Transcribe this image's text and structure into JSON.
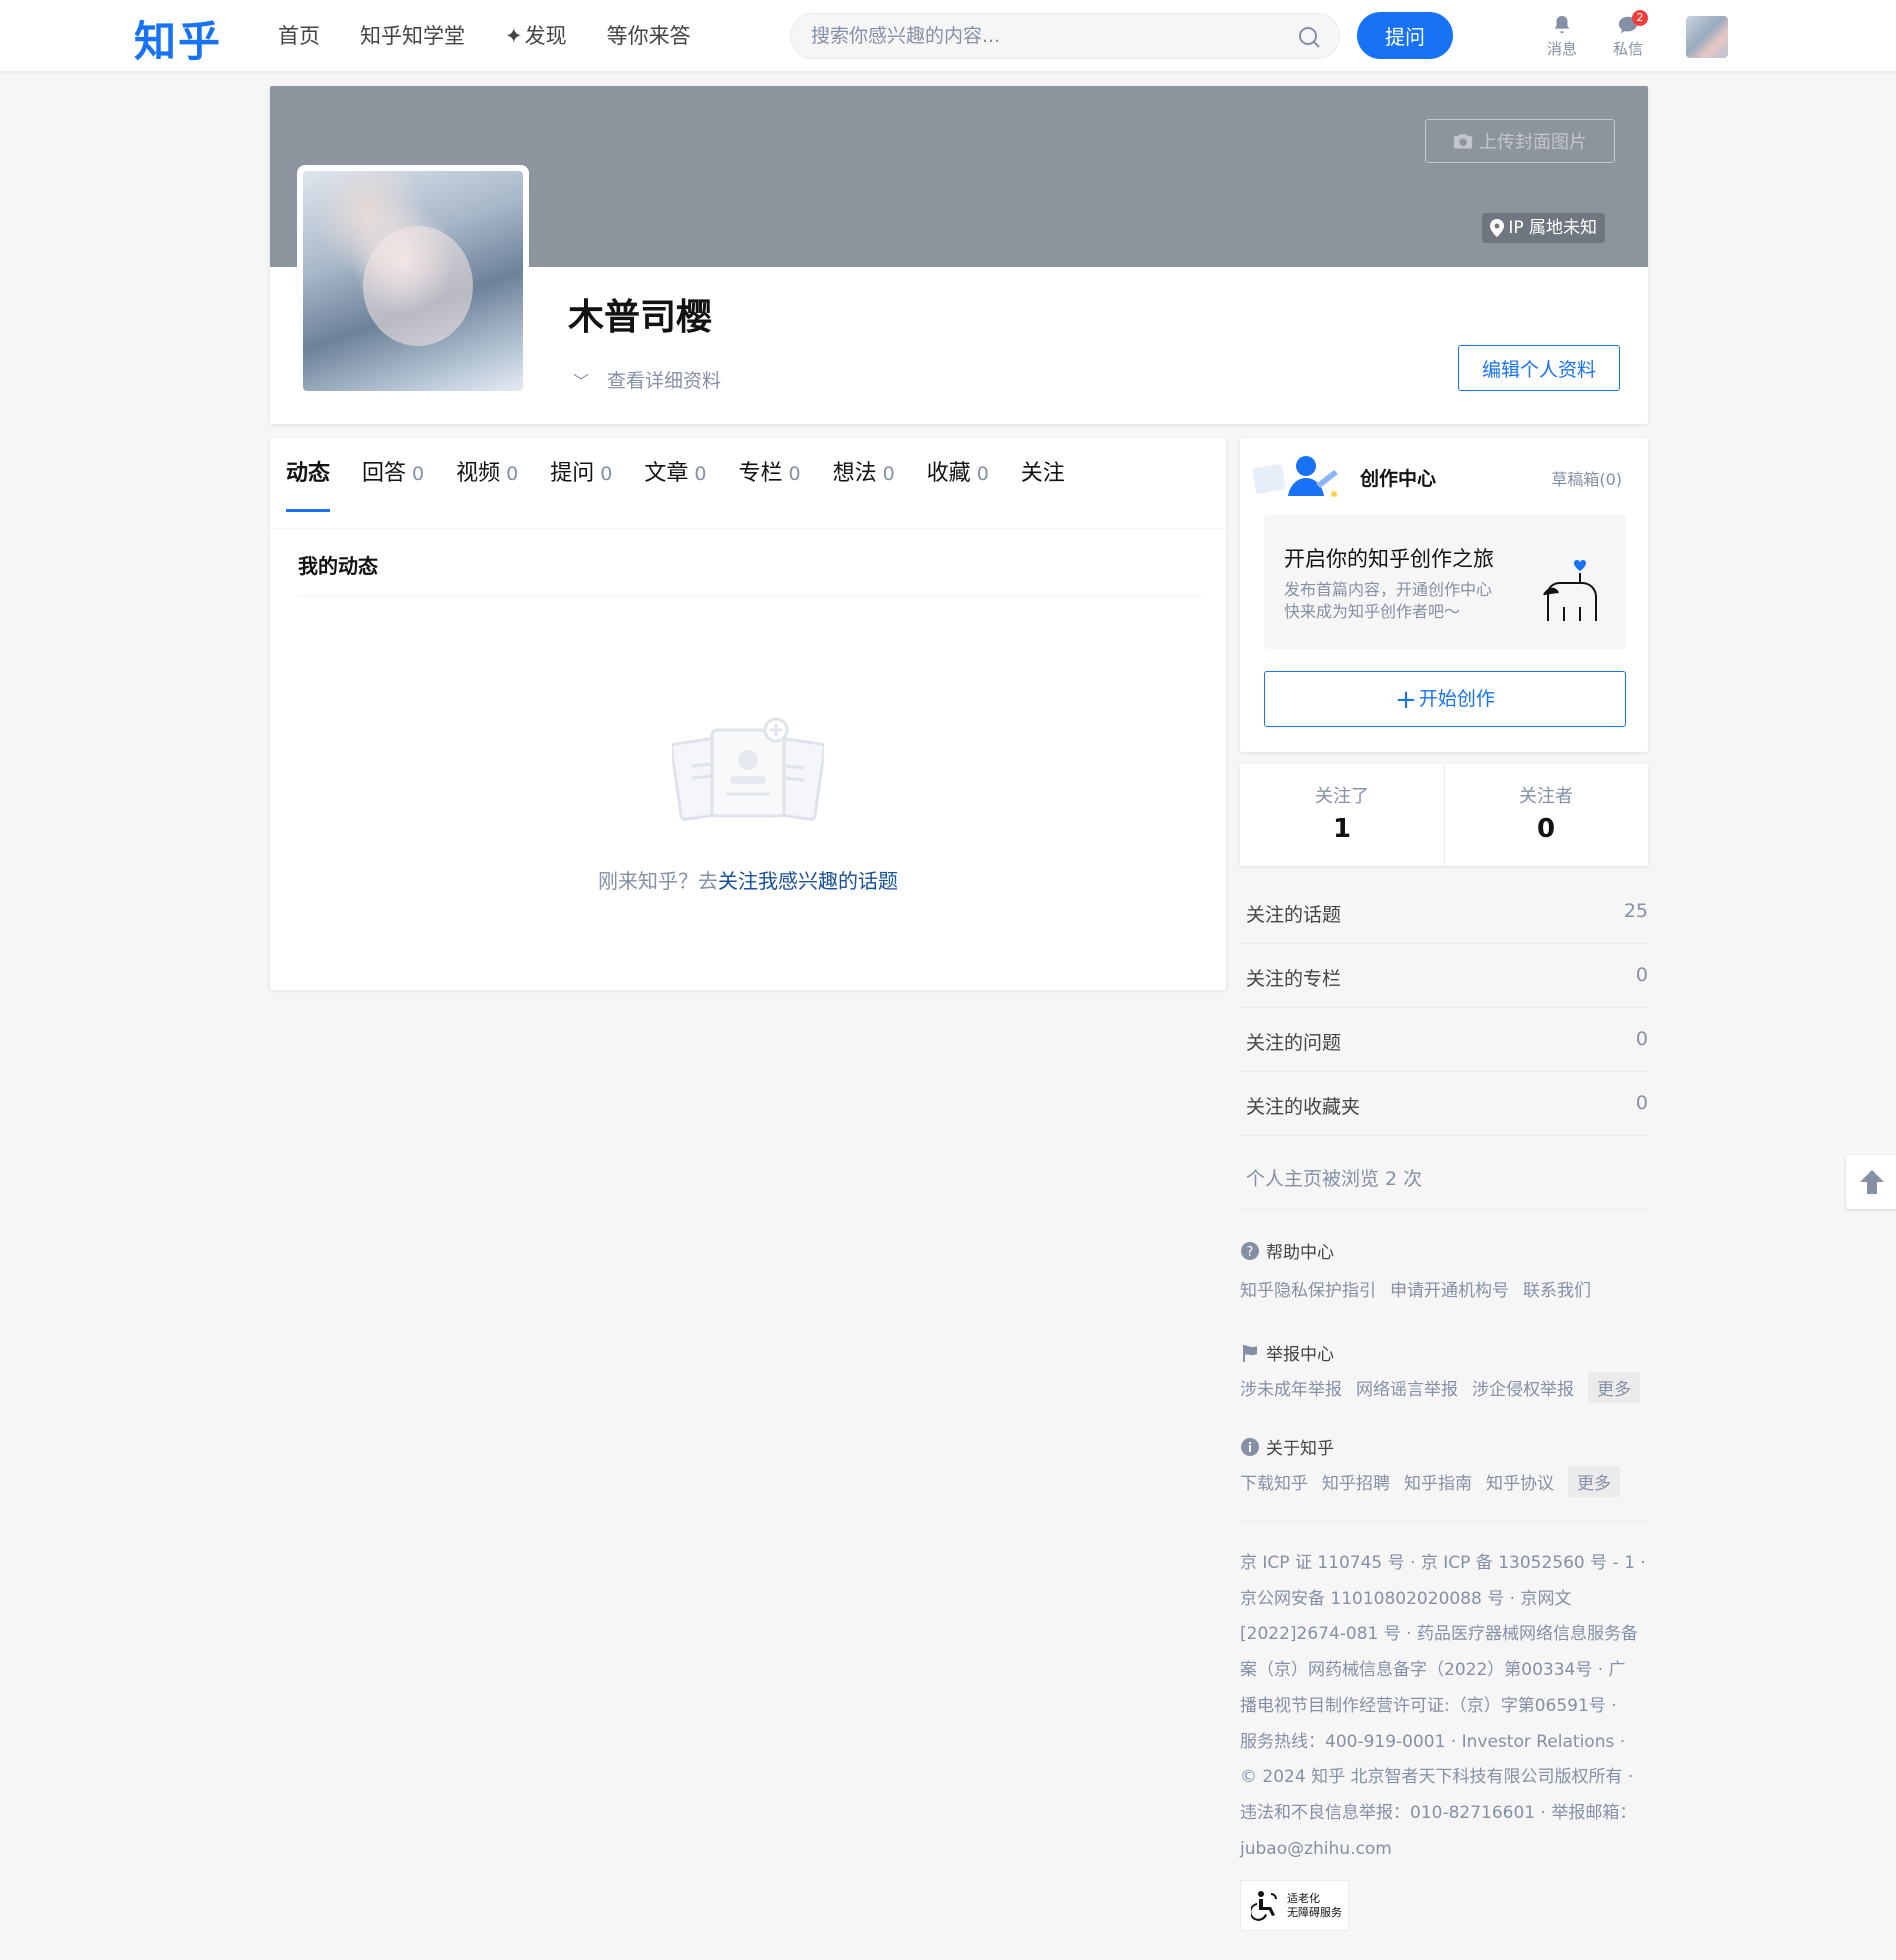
{
  "header": {
    "logo": "知乎",
    "nav": [
      "首页",
      "知乎知学堂",
      "发现",
      "等你来答"
    ],
    "search_placeholder": "搜索你感兴趣的内容...",
    "ask_label": "提问",
    "messages_label": "消息",
    "inbox_label": "私信",
    "inbox_badge": "2",
    "accent": "#1772f6"
  },
  "profile": {
    "upload_cover": "上传封面图片",
    "ip_location": "IP 属地未知",
    "name": "木普司樱",
    "view_details": "查看详细资料",
    "edit_profile": "编辑个人资料"
  },
  "tabs": [
    {
      "label": "动态",
      "count": ""
    },
    {
      "label": "回答",
      "count": "0"
    },
    {
      "label": "视频",
      "count": "0"
    },
    {
      "label": "提问",
      "count": "0"
    },
    {
      "label": "文章",
      "count": "0"
    },
    {
      "label": "专栏",
      "count": "0"
    },
    {
      "label": "想法",
      "count": "0"
    },
    {
      "label": "收藏",
      "count": "0"
    },
    {
      "label": "关注",
      "count": ""
    }
  ],
  "activity": {
    "title": "我的动态",
    "empty_prefix": "刚来知乎？去",
    "empty_link": "关注我感兴趣的话题"
  },
  "creator": {
    "title": "创作中心",
    "drafts": "草稿箱(0)",
    "journey_title": "开启你的知乎创作之旅",
    "journey_line1": "发布首篇内容，开通创作中心",
    "journey_line2": "快来成为知乎创作者吧～",
    "start_label": "开始创作"
  },
  "follow": {
    "following_label": "关注了",
    "following_count": "1",
    "followers_label": "关注者",
    "followers_count": "0"
  },
  "stats": [
    {
      "label": "关注的话题",
      "value": "25"
    },
    {
      "label": "关注的专栏",
      "value": "0"
    },
    {
      "label": "关注的问题",
      "value": "0"
    },
    {
      "label": "关注的收藏夹",
      "value": "0"
    }
  ],
  "views": "个人主页被浏览 2 次",
  "footer": {
    "help_title": "帮助中心",
    "help_links": [
      "知乎隐私保护指引",
      "申请开通机构号",
      "联系我们"
    ],
    "report_title": "举报中心",
    "report_links": [
      "涉未成年举报",
      "网络谣言举报",
      "涉企侵权举报"
    ],
    "about_title": "关于知乎",
    "about_links": [
      "下载知乎",
      "知乎招聘",
      "知乎指南",
      "知乎协议"
    ],
    "more": "更多",
    "legal": [
      "京 ICP 证 110745 号 · 京 ICP 备 13052560 号 - 1 ·",
      "京公网安备 11010802020088 号 · 京网文",
      "[2022]2674-081 号 · 药品医疗器械网络信息服务备",
      "案（京）网药械信息备字（2022）第00334号 · 广",
      "播电视节目制作经营许可证:（京）字第06591号 ·",
      "服务热线：400-919-0001 · Investor Relations ·",
      "© 2024 知乎 北京智者天下科技有限公司版权所有 ·",
      "违法和不良信息举报：010-82716601 · 举报邮箱：",
      "jubao@zhihu.com"
    ],
    "a11y_line1": "适老化",
    "a11y_line2": "无障碍服务"
  }
}
